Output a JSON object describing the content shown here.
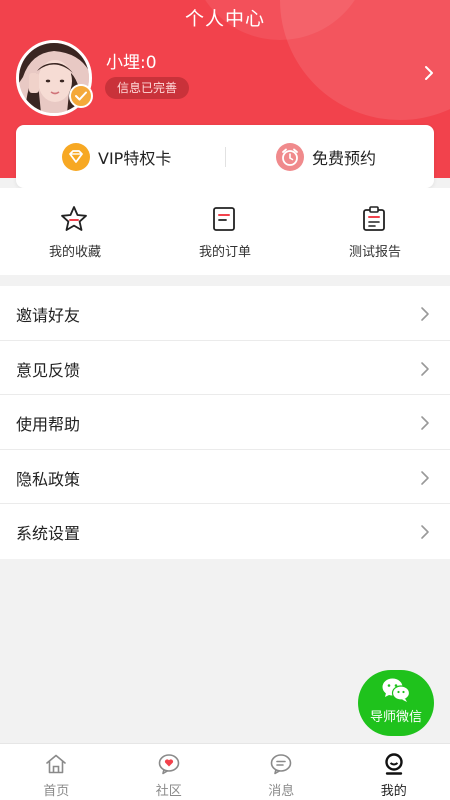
{
  "header": {
    "title": "个人中心",
    "username": "小埋:0",
    "info_status": "信息已完善",
    "accent_color": "#f2424c"
  },
  "card": {
    "vip_label": "VIP特权卡",
    "appointment_label": "免费预约"
  },
  "quick_actions": [
    {
      "label": "我的收藏",
      "icon": "star-icon"
    },
    {
      "label": "我的订单",
      "icon": "order-icon"
    },
    {
      "label": "测试报告",
      "icon": "clipboard-icon"
    }
  ],
  "menu": [
    {
      "label": "邀请好友"
    },
    {
      "label": "意见反馈"
    },
    {
      "label": "使用帮助"
    },
    {
      "label": "隐私政策"
    },
    {
      "label": "系统设置"
    }
  ],
  "floating_button": {
    "label": "导师微信",
    "color": "#1fc21c",
    "icon": "wechat-icon"
  },
  "tabbar": {
    "active_index": 3,
    "tabs": [
      {
        "label": "首页",
        "icon": "home-icon"
      },
      {
        "label": "社区",
        "icon": "heart-bubble-icon"
      },
      {
        "label": "消息",
        "icon": "message-icon"
      },
      {
        "label": "我的",
        "icon": "profile-icon"
      }
    ]
  }
}
